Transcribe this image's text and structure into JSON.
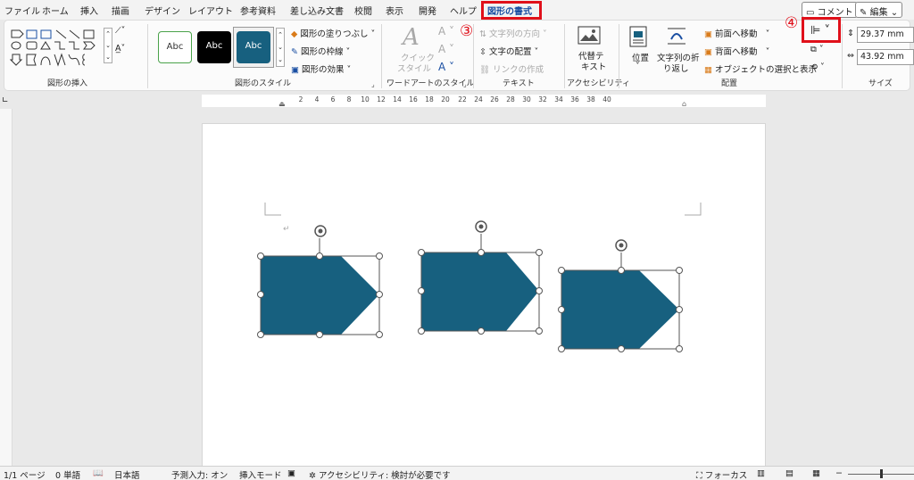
{
  "tabs": [
    {
      "label": "ファイル"
    },
    {
      "label": "ホーム"
    },
    {
      "label": "挿入"
    },
    {
      "label": "描画"
    },
    {
      "label": "デザイン"
    },
    {
      "label": "レイアウト"
    },
    {
      "label": "参考資料"
    },
    {
      "label": "差し込み文書"
    },
    {
      "label": "校閲"
    },
    {
      "label": "表示"
    },
    {
      "label": "開発"
    },
    {
      "label": "ヘルプ"
    },
    {
      "label": "図形の書式"
    }
  ],
  "top_right": {
    "comment_label": "コメント",
    "edit_label": "編集"
  },
  "annotations": {
    "step3": "③",
    "step4": "④"
  },
  "ribbon": {
    "insert_shapes": {
      "label": "図形の挿入"
    },
    "shape_styles": {
      "label": "図形のスタイル",
      "sample_text": "Abc",
      "fill_label": "図形の塗りつぶし",
      "outline_label": "図形の枠線",
      "effects_label": "図形の効果"
    },
    "wordart": {
      "label": "ワードアートのスタイル",
      "quick_style_line1": "クイック",
      "quick_style_line2": "スタイル"
    },
    "text": {
      "label": "テキスト",
      "direction_label": "文字列の方向",
      "align_label": "文字の配置",
      "link_label": "リンクの作成"
    },
    "accessibility": {
      "label": "アクセシビリティ",
      "alt_text_line1": "代替テ",
      "alt_text_line2": "キスト"
    },
    "arrange": {
      "label": "配置",
      "position_label": "位置",
      "wrap_line1": "文字列の折",
      "wrap_line2": "り返し",
      "bring_forward_label": "前面へ移動",
      "send_backward_label": "背面へ移動",
      "selection_pane_label": "オブジェクトの選択と表示"
    },
    "size": {
      "label": "サイズ",
      "height": "29.37 mm",
      "width": "43.92 mm"
    }
  },
  "ruler": {
    "numbers": [
      "2",
      "4",
      "6",
      "8",
      "10",
      "12",
      "14",
      "16",
      "18",
      "20",
      "22",
      "24",
      "26",
      "28",
      "30",
      "32",
      "34",
      "36",
      "38",
      "40"
    ]
  },
  "colors": {
    "shape_fill": "#17607f",
    "accent_red": "#e0101a",
    "accent_blue": "#1a4fa3"
  },
  "status": {
    "page": "1/1 ページ",
    "words": "0 単語",
    "language": "日本語",
    "predictive": "予測入力: オン",
    "insert_mode": "挿入モード",
    "accessibility": "アクセシビリティ: 検討が必要です",
    "focus": "フォーカス"
  }
}
